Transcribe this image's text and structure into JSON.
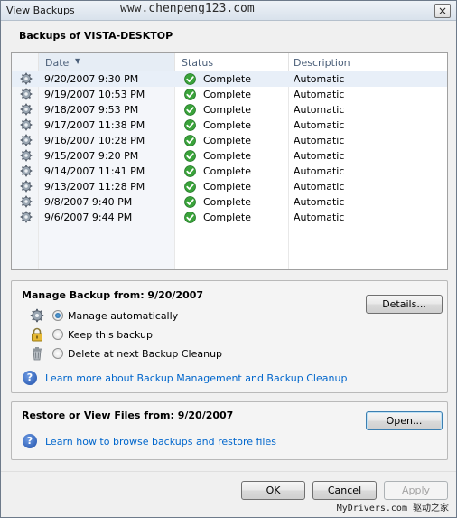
{
  "window": {
    "title": "View Backups",
    "title_watermark": "www.chenpeng123.com",
    "close_label": "×"
  },
  "heading": "Backups of VISTA-DESKTOP",
  "columns": [
    "Date",
    "Status",
    "Description"
  ],
  "backups": [
    {
      "date": "9/20/2007 9:30 PM",
      "status": "Complete",
      "description": "Automatic"
    },
    {
      "date": "9/19/2007 10:53 PM",
      "status": "Complete",
      "description": "Automatic"
    },
    {
      "date": "9/18/2007 9:53 PM",
      "status": "Complete",
      "description": "Automatic"
    },
    {
      "date": "9/17/2007 11:38 PM",
      "status": "Complete",
      "description": "Automatic"
    },
    {
      "date": "9/16/2007 10:28 PM",
      "status": "Complete",
      "description": "Automatic"
    },
    {
      "date": "9/15/2007 9:20 PM",
      "status": "Complete",
      "description": "Automatic"
    },
    {
      "date": "9/14/2007 11:41 PM",
      "status": "Complete",
      "description": "Automatic"
    },
    {
      "date": "9/13/2007 11:28 PM",
      "status": "Complete",
      "description": "Automatic"
    },
    {
      "date": "9/8/2007 9:40 PM",
      "status": "Complete",
      "description": "Automatic"
    },
    {
      "date": "9/6/2007 9:44 PM",
      "status": "Complete",
      "description": "Automatic"
    }
  ],
  "manage": {
    "title": "Manage Backup from: 9/20/2007",
    "details_button": "Details...",
    "options": [
      {
        "label": "Manage automatically",
        "icon": "gear-icon",
        "selected": true
      },
      {
        "label": "Keep this backup",
        "icon": "lock-icon",
        "selected": false
      },
      {
        "label": "Delete at next Backup Cleanup",
        "icon": "trash-icon",
        "selected": false
      }
    ],
    "help_link": "Learn more about Backup Management and Backup Cleanup"
  },
  "restore": {
    "title": "Restore or View Files from: 9/20/2007",
    "open_button": "Open...",
    "help_link": "Learn how to browse backups and restore files"
  },
  "buttons": {
    "ok": "OK",
    "cancel": "Cancel",
    "apply": "Apply"
  },
  "watermark_bottom": "MyDrivers.com 驱动之家",
  "colors": {
    "link": "#0066cc",
    "header_text": "#4c607a",
    "selection": "#e8eff8"
  }
}
